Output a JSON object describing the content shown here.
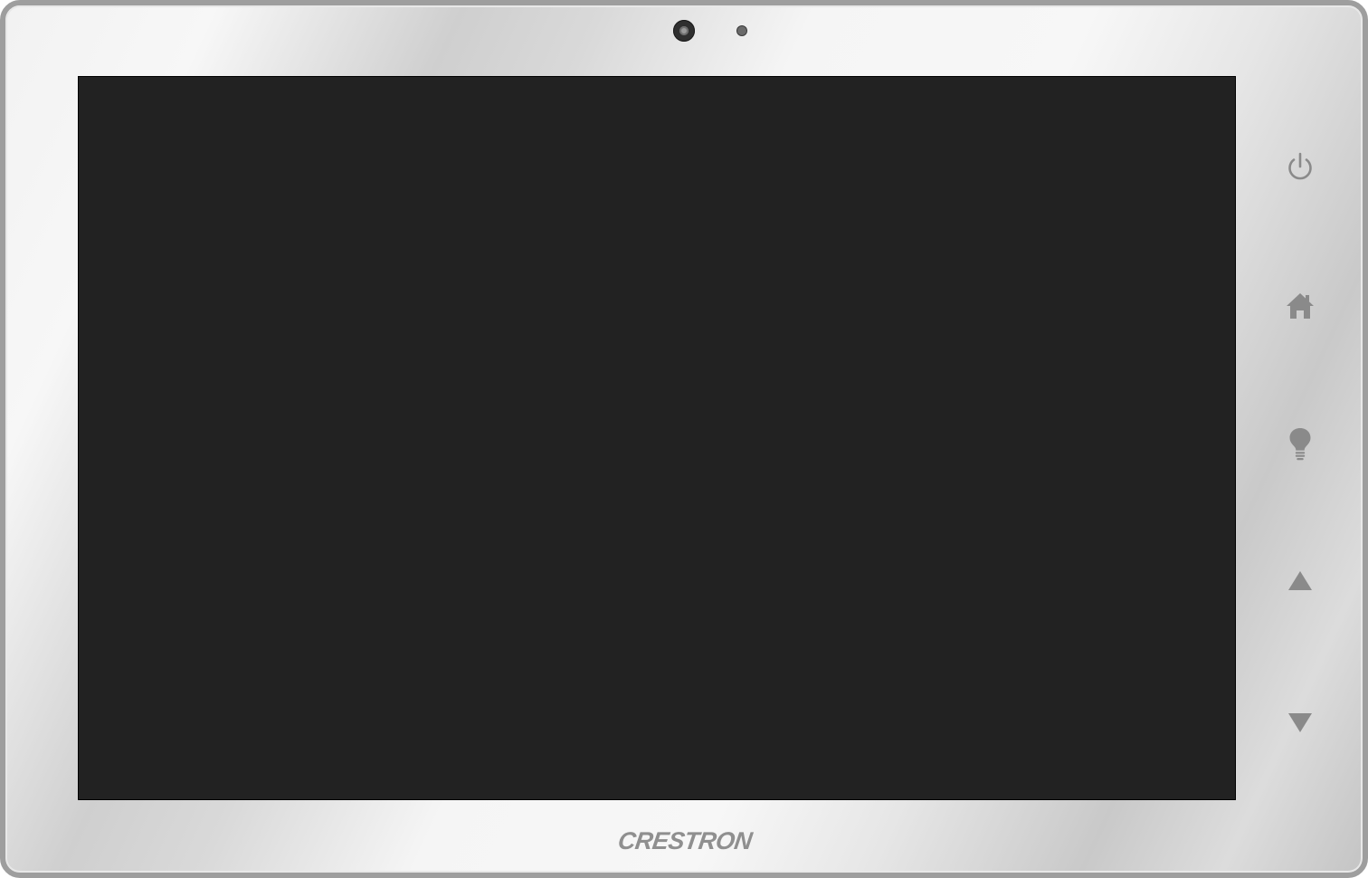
{
  "device": {
    "brand_logo": "CRESTRON",
    "bezel_color": "#f2f2f2",
    "frame_color": "#9e9e9e",
    "screen_color": "#222222",
    "button_color": "#8a8a8a"
  },
  "top_bezel": {
    "camera_icon": "camera-icon",
    "sensor_icon": "light-sensor-icon"
  },
  "side_buttons": [
    {
      "name": "power",
      "icon": "power-icon"
    },
    {
      "name": "home",
      "icon": "home-icon"
    },
    {
      "name": "lights",
      "icon": "light-bulb-icon"
    },
    {
      "name": "up",
      "icon": "triangle-up-icon"
    },
    {
      "name": "down",
      "icon": "triangle-down-icon"
    }
  ]
}
